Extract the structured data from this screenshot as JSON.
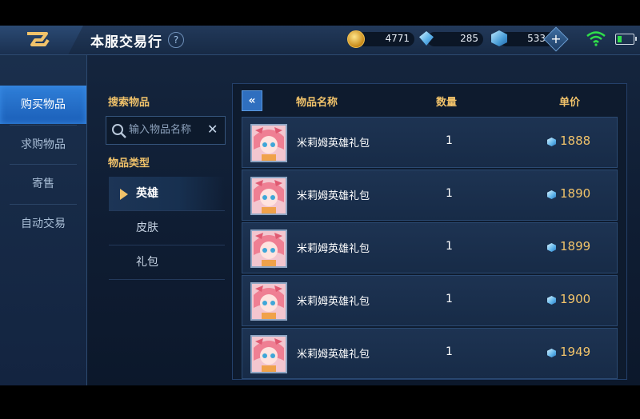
{
  "header": {
    "title": "本服交易行",
    "help_label": "?"
  },
  "resources": {
    "gold": "4771",
    "diamond": "285",
    "coupon": "533",
    "add_label": "+"
  },
  "battery_level": 0.3,
  "nav": {
    "items": [
      {
        "label": "购买物品",
        "active": true
      },
      {
        "label": "求购物品",
        "active": false
      },
      {
        "label": "寄售",
        "active": false
      },
      {
        "label": "自动交易",
        "active": false
      }
    ]
  },
  "filter": {
    "search_label": "搜索物品",
    "search_placeholder": "输入物品名称",
    "clear_label": "✕",
    "category_label": "物品类型",
    "categories": [
      {
        "label": "英雄",
        "active": true
      },
      {
        "label": "皮肤",
        "active": false
      },
      {
        "label": "礼包",
        "active": false
      }
    ]
  },
  "table": {
    "collapse_label": "«",
    "headers": {
      "name": "物品名称",
      "quantity": "数量",
      "price": "单价"
    },
    "rows": [
      {
        "name": "米莉姆英雄礼包",
        "quantity": "1",
        "price": "1888"
      },
      {
        "name": "米莉姆英雄礼包",
        "quantity": "1",
        "price": "1890"
      },
      {
        "name": "米莉姆英雄礼包",
        "quantity": "1",
        "price": "1899"
      },
      {
        "name": "米莉姆英雄礼包",
        "quantity": "1",
        "price": "1900"
      },
      {
        "name": "米莉姆英雄礼包",
        "quantity": "1",
        "price": "1949"
      }
    ]
  },
  "icons": {
    "back": "back-arrow-icon",
    "gold": "gold-coin-icon",
    "diamond": "diamond-icon",
    "coupon": "coupon-cube-icon",
    "search": "search-icon",
    "wifi": "wifi-icon",
    "battery": "battery-icon",
    "price": "price-gem-icon"
  },
  "colors": {
    "accent_gold": "#f0c26a",
    "active_blue": "#2f7fd8",
    "wifi_green": "#2fe04a"
  }
}
